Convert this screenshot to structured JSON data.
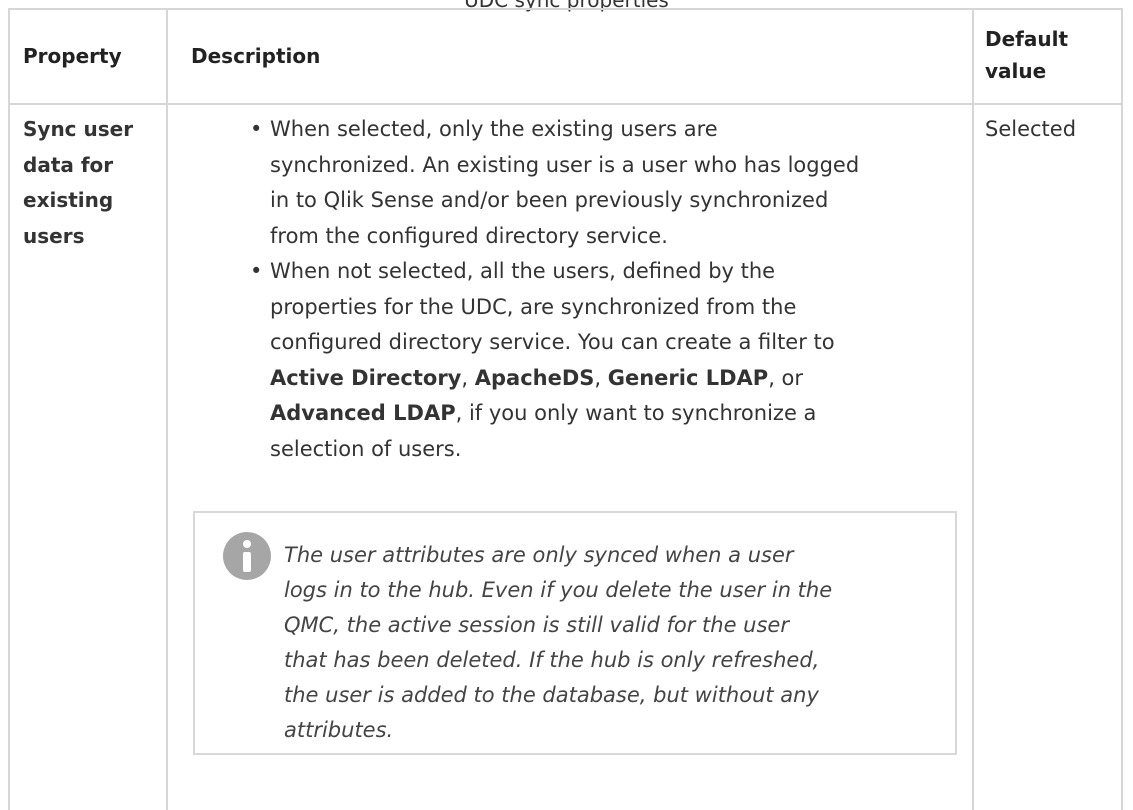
{
  "caption": "UDC sync properties",
  "table": {
    "headers": {
      "property": "Property",
      "description": "Description",
      "default_value_line1": "Default",
      "default_value_line2": "value"
    },
    "rows": [
      {
        "property_lines": [
          "Sync user",
          "data for",
          "existing",
          "users"
        ],
        "bullet1_lines": [
          "When selected, only the existing users are",
          "synchronized. An existing user is a user who has logged",
          "in to Qlik Sense and/or been previously synchronized",
          "from the configured directory service."
        ],
        "bullet2_lines_plain": [
          "When not selected, all the users, defined by the",
          "properties for the UDC, are synchronized from the",
          "configured directory service. You can create a filter to"
        ],
        "bullet2_filter_line": {
          "b1": "Active Directory",
          "sep1": ", ",
          "b2": "ApacheDS",
          "sep2": ", ",
          "b3": "Generic LDAP",
          "sep3": ", or"
        },
        "bullet2_last_line": {
          "b4": "Advanced LDAP",
          "rest": ", if you only want to synchronize a"
        },
        "bullet2_final_line": "selection of users.",
        "note_lines": [
          "The user attributes are only synced when a user",
          "logs in to the hub. Even if you delete the user in the",
          "QMC, the active session is still valid for the user",
          "that has been deleted. If the hub is only refreshed,",
          "the user is added to the database, but without any",
          "attributes."
        ],
        "default_value": "Selected"
      }
    ]
  }
}
